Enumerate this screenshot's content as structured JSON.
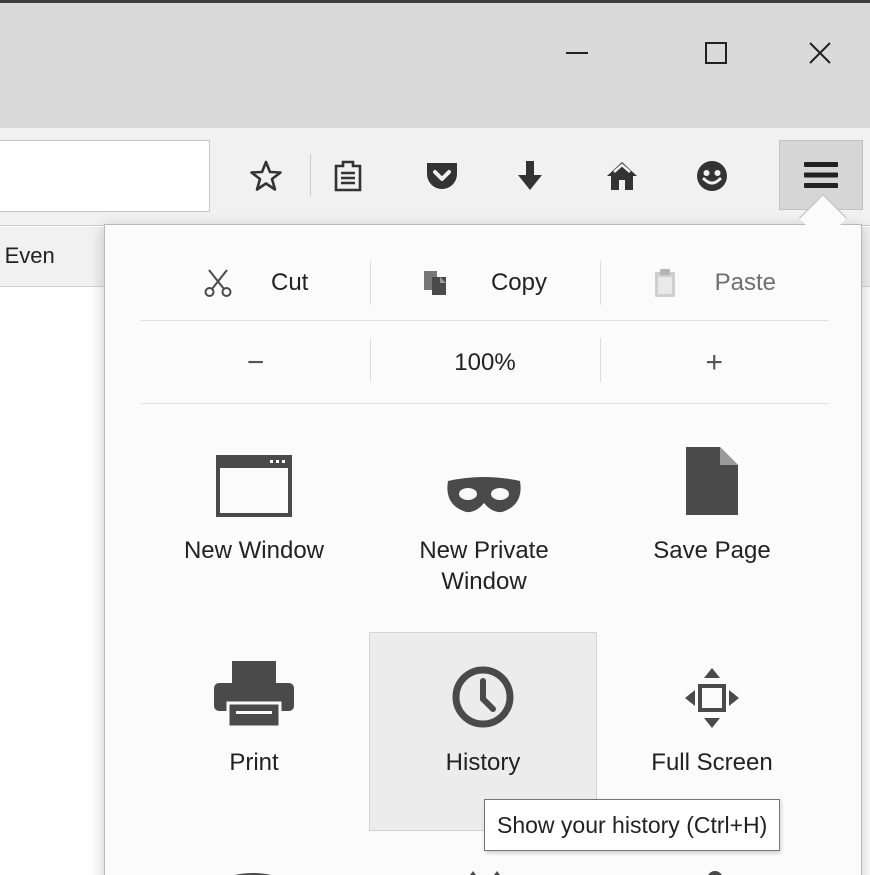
{
  "window": {
    "controls": {
      "minimize": "minimize-icon",
      "maximize": "maximize-icon",
      "close": "close-icon"
    }
  },
  "toolbar": {
    "url_value": "",
    "icons": [
      "star-icon",
      "reading-list-icon",
      "pocket-icon",
      "download-icon",
      "home-icon",
      "hello-icon",
      "hamburger-menu-icon"
    ]
  },
  "bookmarks": {
    "items": [
      {
        "label": "na Even"
      }
    ]
  },
  "panel": {
    "edit": {
      "cut": "Cut",
      "copy": "Copy",
      "paste": "Paste"
    },
    "zoom": {
      "out": "−",
      "level": "100%",
      "in": "+"
    },
    "items": [
      {
        "label": "New Window",
        "icon": "new-window-icon"
      },
      {
        "label": "New Private\nWindow",
        "icon": "private-mask-icon"
      },
      {
        "label": "Save Page",
        "icon": "save-page-icon"
      },
      {
        "label": "Print",
        "icon": "printer-icon"
      },
      {
        "label": "History",
        "icon": "history-clock-icon",
        "selected": true
      },
      {
        "label": "Full Screen",
        "icon": "full-screen-icon"
      }
    ]
  },
  "tooltip": {
    "text": "Show your history (Ctrl+H)"
  },
  "colors": {
    "icon": "#4a4a4a",
    "titlebar": "#dadada",
    "toolbar": "#f1f1f1",
    "panel": "#fbfbfb",
    "selected": "#ececec"
  }
}
